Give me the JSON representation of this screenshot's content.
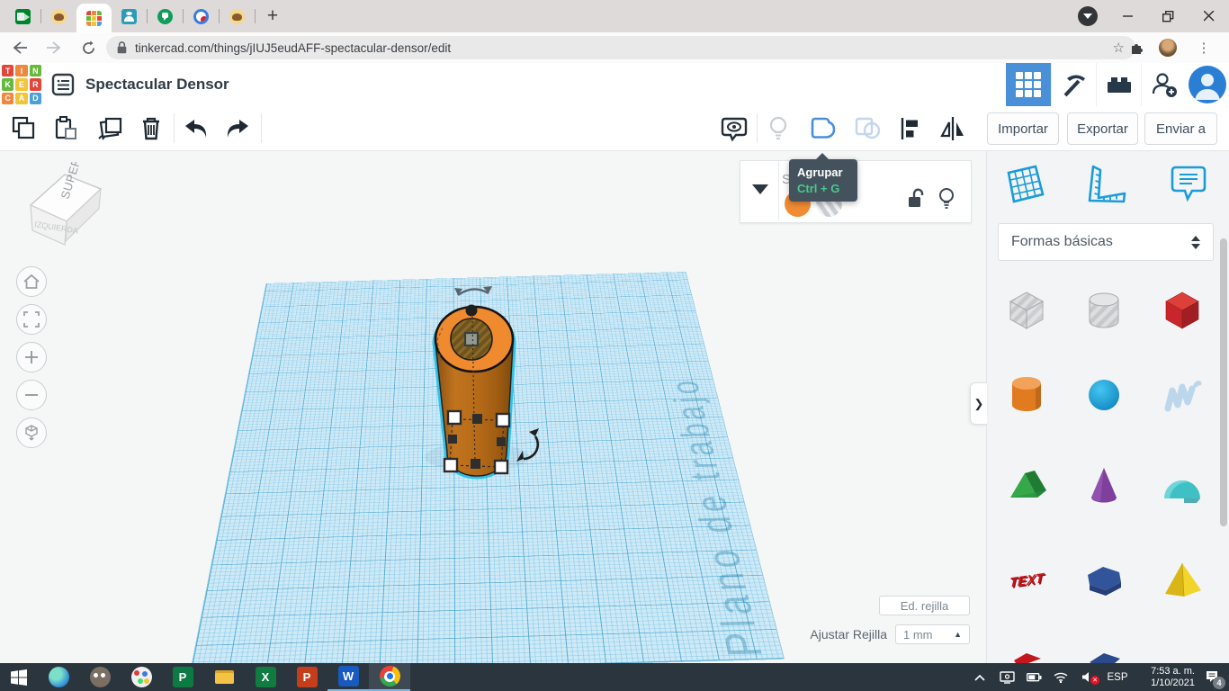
{
  "browser": {
    "url": "tinkercad.com/things/jIUJ5eudAFF-spectacular-densor/edit",
    "new_tab_label": "+",
    "tab_icons": [
      "meet",
      "emoji",
      "tinkercad",
      "contacts",
      "hangouts",
      "currents",
      "emoji"
    ]
  },
  "header": {
    "title": "Spectacular Densor",
    "logo": [
      "T",
      "I",
      "N",
      "K",
      "E",
      "R",
      "C",
      "A",
      "D"
    ]
  },
  "toolbar": {
    "import_label": "Importar",
    "export_label": "Exportar",
    "send_label": "Enviar a",
    "icons": [
      "copy",
      "paste",
      "duplicate",
      "delete",
      "undo",
      "redo",
      "show-all",
      "hide",
      "group",
      "ungroup",
      "align",
      "mirror"
    ]
  },
  "tooltip": {
    "label": "Agrupar",
    "shortcut": "Ctrl + G"
  },
  "inspector": {
    "clipped_label": "Sh",
    "swatches": [
      "orange",
      "multi-material"
    ],
    "icons": [
      "unlock",
      "bulb"
    ]
  },
  "canvas": {
    "watermark": "Plano de trabajo",
    "viewcube_top": "SUPERIOR",
    "viewcube_left": "IZQUIERDA",
    "nav_icons": [
      "home",
      "fit-view",
      "zoom-in",
      "zoom-out",
      "ortho-view"
    ]
  },
  "grid": {
    "edit_label": "Ed. rejilla",
    "snap_label": "Ajustar Rejilla",
    "snap_value": "1 mm"
  },
  "sidebar": {
    "category_label": "Formas básicas",
    "panel_icons": [
      "workplane",
      "ruler",
      "notes"
    ],
    "shapes": [
      "box-transparent",
      "cylinder-transparent",
      "box-red",
      "cylinder-orange",
      "sphere-blue",
      "scribble",
      "roof-green",
      "cone-purple",
      "round-roof-teal",
      "text-red",
      "polygon-blue",
      "pyramid-yellow"
    ],
    "text_shape_label": "TEXT"
  },
  "taskbar": {
    "language": "ESP",
    "time": "7:53 a. m.",
    "date": "1/10/2021",
    "notification_count": "4",
    "app_icons": [
      "start",
      "edge",
      "gimp",
      "paint3d",
      "publisher",
      "explorer",
      "excel",
      "powerpoint",
      "word",
      "chrome"
    ],
    "tray_icons": [
      "hidden-icons",
      "cast",
      "battery",
      "wifi",
      "volume-muted"
    ]
  },
  "colors": {
    "accent_blue": "#4a90d9",
    "selection_cyan": "#2fc3e9",
    "plane_blue": "#cfeaf7",
    "object_orange": "#f08a2e",
    "tooltip_bg": "#43525c",
    "shortcut_green": "#4cc88d",
    "taskbar_bg": "#2b353d"
  }
}
